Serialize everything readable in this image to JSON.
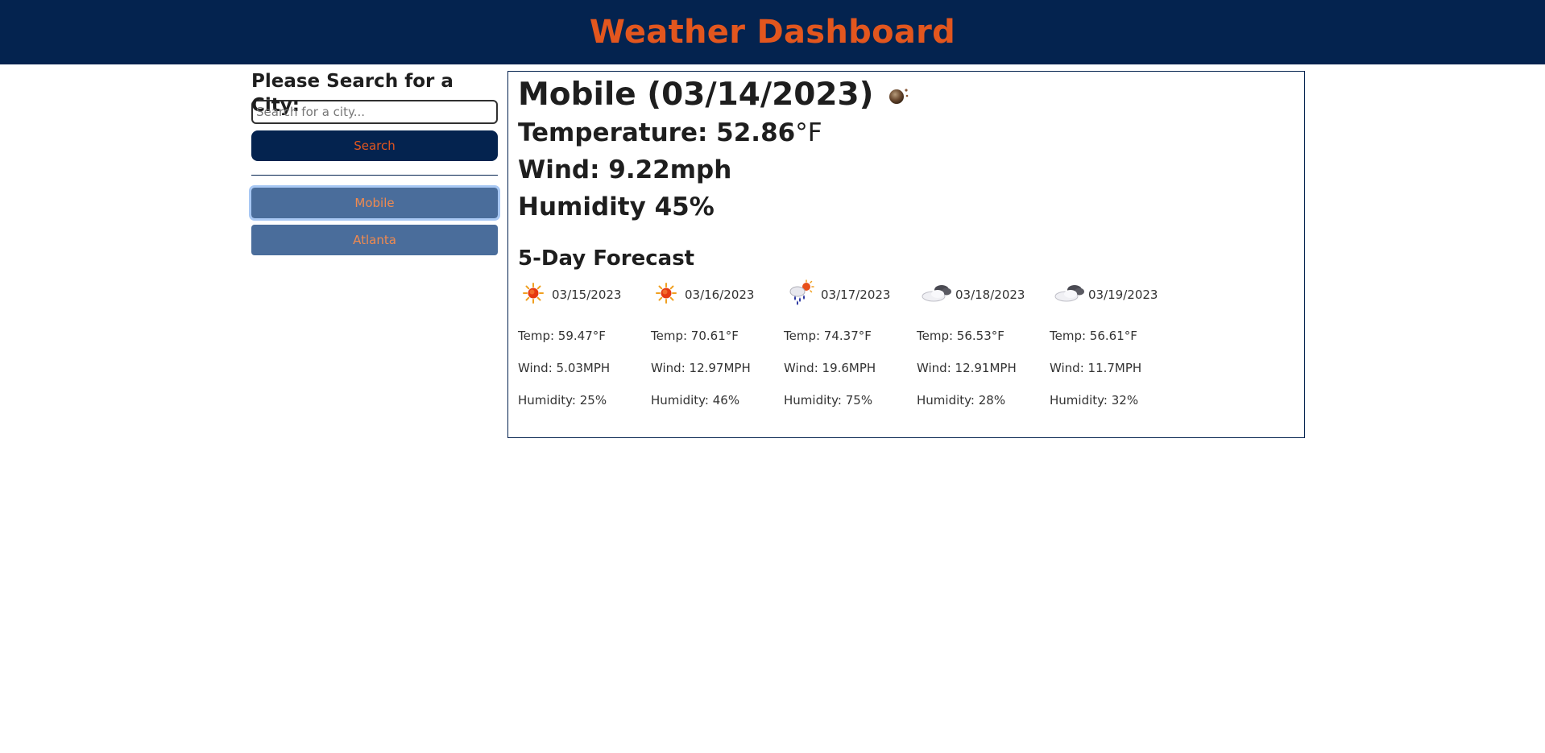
{
  "header": {
    "title": "Weather Dashboard"
  },
  "sidebar": {
    "heading": "Please Search for a City:",
    "search_placeholder": "Search for a city...",
    "search_value": "",
    "search_button": "Search",
    "history": [
      {
        "label": "Mobile",
        "active": true
      },
      {
        "label": "Atlanta",
        "active": false
      }
    ]
  },
  "current": {
    "title": "Mobile (03/14/2023)",
    "icon": "moon-icon",
    "temperature": "Temperature: 52.86",
    "temp_unit": "°F",
    "wind": "Wind: 9.22mph",
    "humidity": "Humidity 45%"
  },
  "forecast": {
    "title": "5-Day Forecast",
    "days": [
      {
        "date": "03/15/2023",
        "icon": "sun-icon",
        "temp": "Temp: 59.47°F",
        "wind": "Wind: 5.03MPH",
        "humidity": "Humidity: 25%"
      },
      {
        "date": "03/16/2023",
        "icon": "sun-icon",
        "temp": "Temp: 70.61°F",
        "wind": "Wind: 12.97MPH",
        "humidity": "Humidity: 46%"
      },
      {
        "date": "03/17/2023",
        "icon": "rain-sun-icon",
        "temp": "Temp: 74.37°F",
        "wind": "Wind: 19.6MPH",
        "humidity": "Humidity: 75%"
      },
      {
        "date": "03/18/2023",
        "icon": "cloudy-icon",
        "temp": "Temp: 56.53°F",
        "wind": "Wind: 12.91MPH",
        "humidity": "Humidity: 28%"
      },
      {
        "date": "03/19/2023",
        "icon": "cloudy-icon",
        "temp": "Temp: 56.61°F",
        "wind": "Wind: 11.7MPH",
        "humidity": "Humidity: 32%"
      }
    ]
  },
  "colors": {
    "header_bg": "#04234f",
    "accent_orange": "#e2561e",
    "history_button_bg": "#4a6d9b"
  }
}
